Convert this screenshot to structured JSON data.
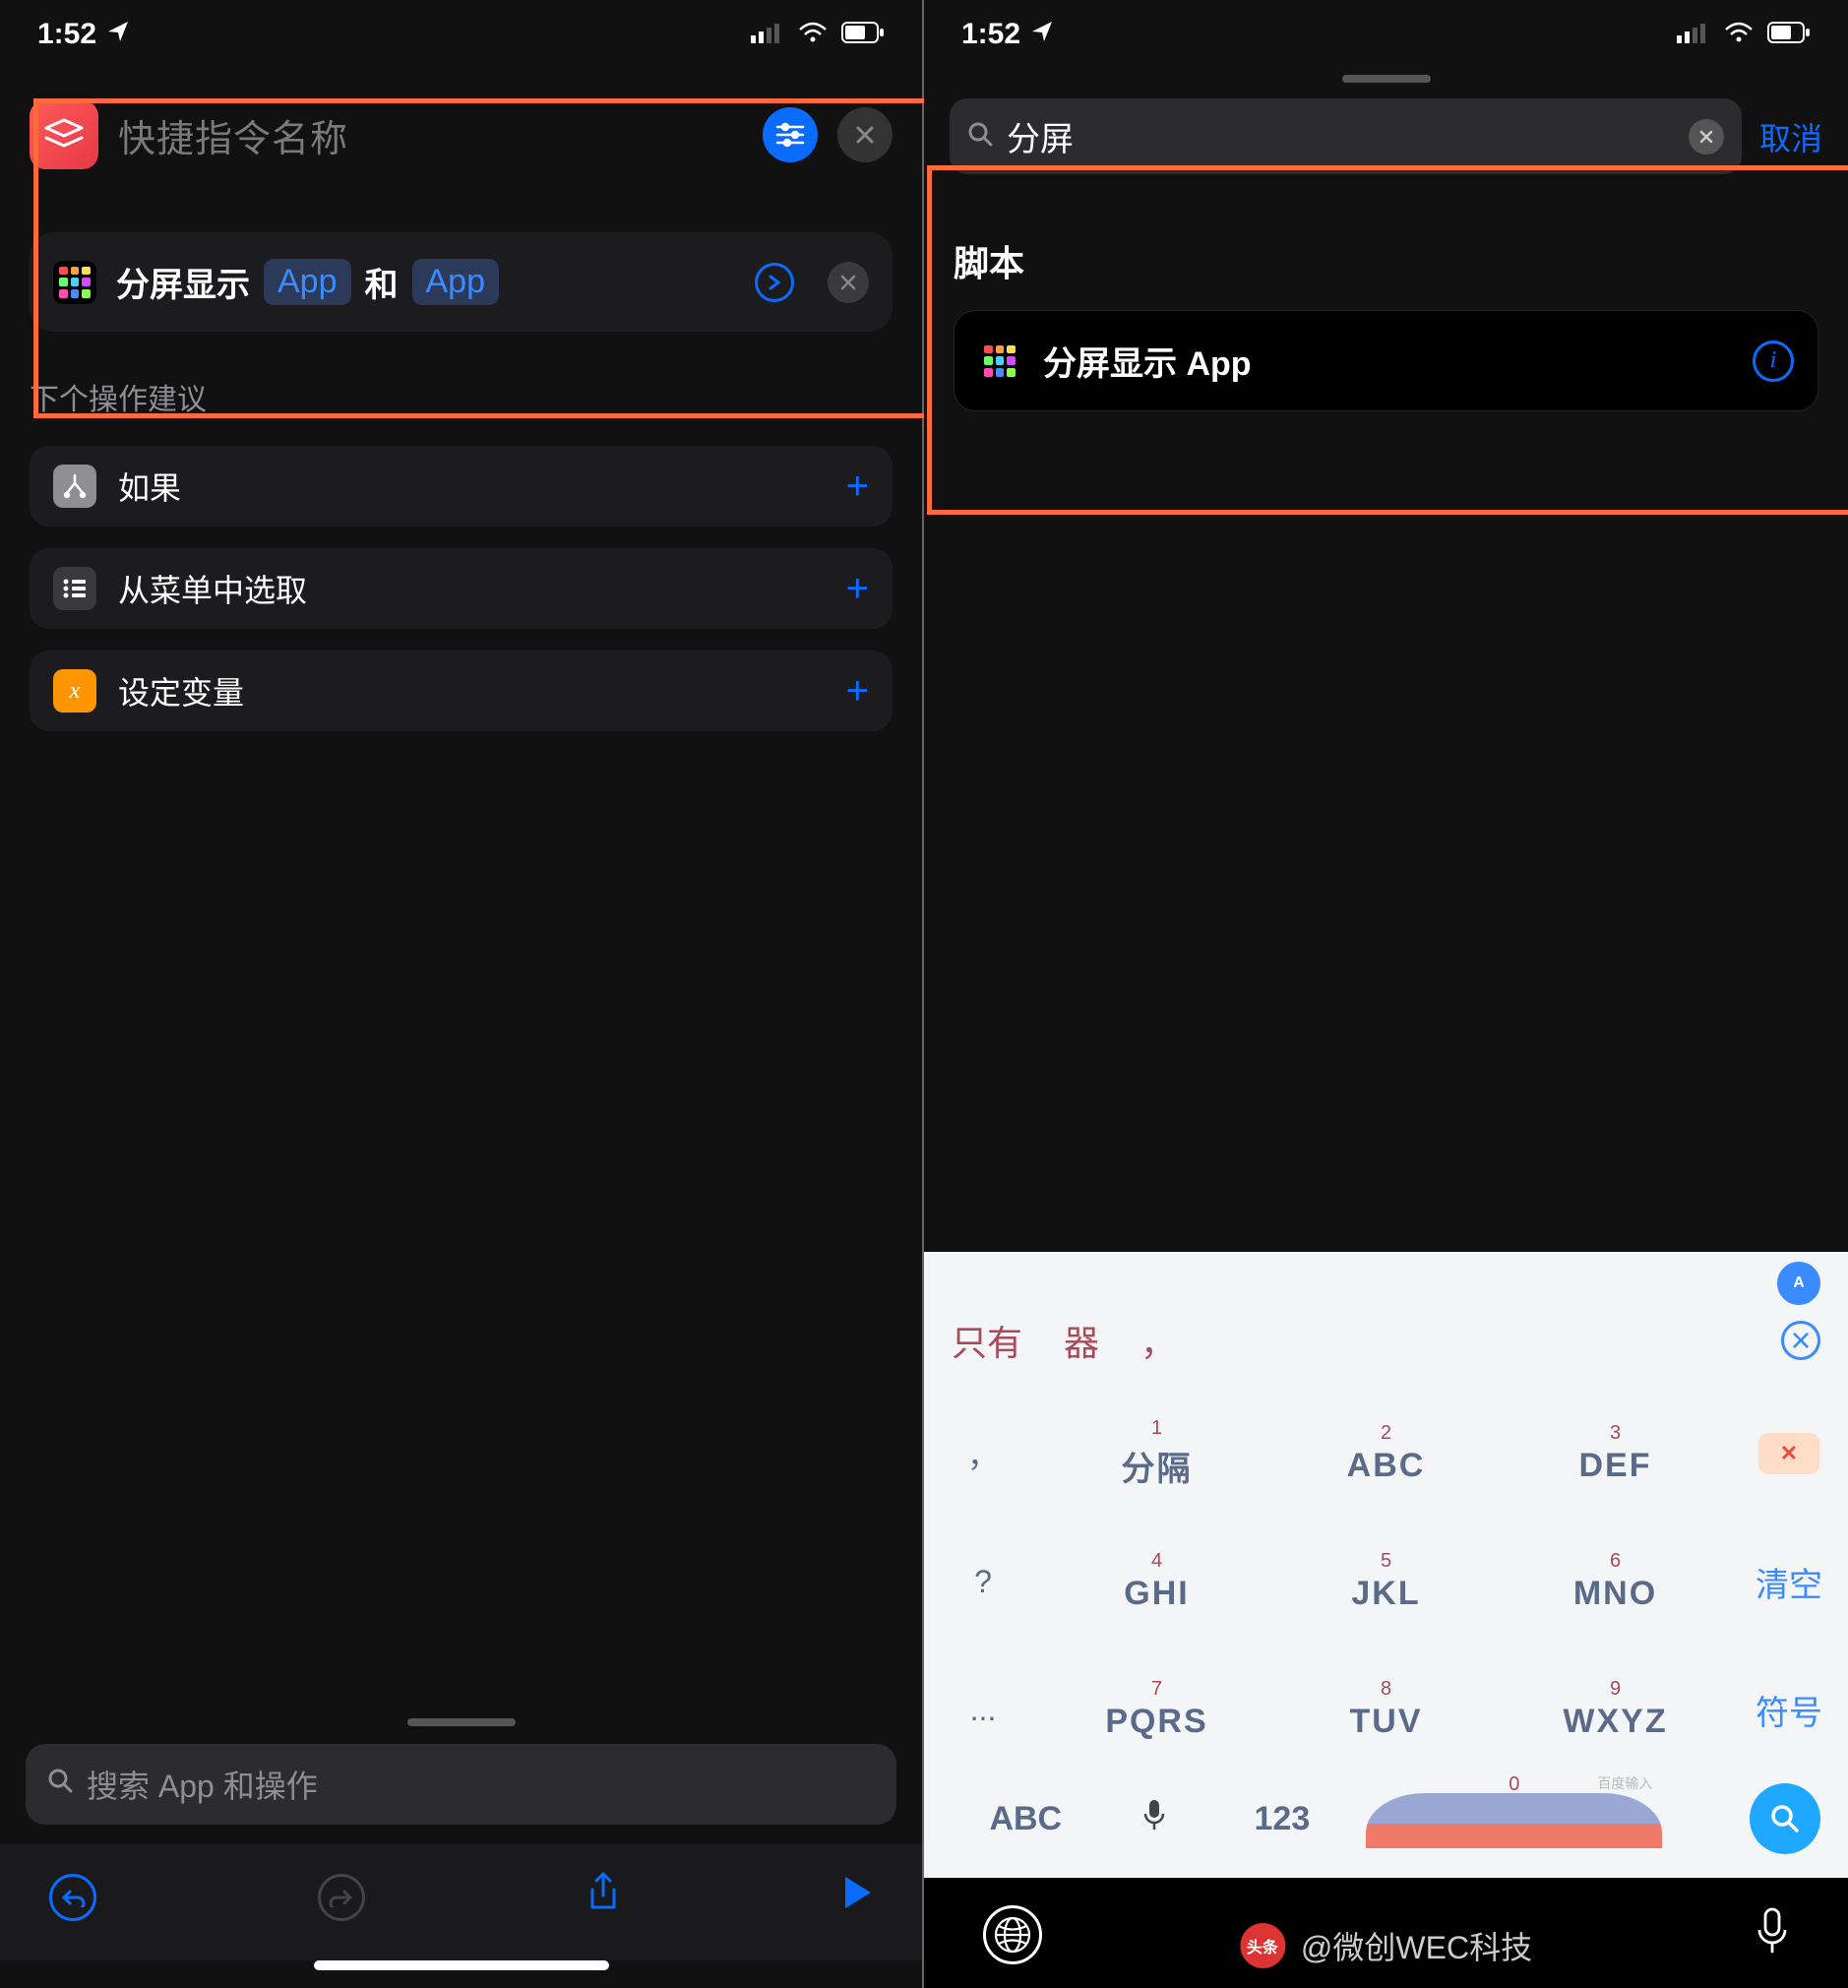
{
  "status": {
    "time": "1:52"
  },
  "left": {
    "title_placeholder": "快捷指令名称",
    "action": {
      "label": "分屏显示",
      "param1": "App",
      "connector": "和",
      "param2": "App"
    },
    "suggestions_header": "下个操作建议",
    "suggestions": [
      {
        "icon": "Y",
        "label": "如果"
      },
      {
        "icon": "≣",
        "label": "从菜单中选取"
      },
      {
        "icon": "x",
        "label": "设定变量"
      }
    ],
    "search_placeholder": "搜索 App 和操作"
  },
  "right": {
    "search_value": "分屏",
    "cancel": "取消",
    "section": "脚本",
    "result_label": "分屏显示 App",
    "candidates": [
      "只有",
      "器",
      "，"
    ],
    "keyboard": {
      "rows": [
        {
          "left": "，",
          "k1": {
            "n": "1",
            "t": "分隔"
          },
          "k2": {
            "n": "2",
            "t": "ABC"
          },
          "k3": {
            "n": "3",
            "t": "DEF"
          },
          "right": "del"
        },
        {
          "left": "?",
          "k1": {
            "n": "4",
            "t": "GHI"
          },
          "k2": {
            "n": "5",
            "t": "JKL"
          },
          "k3": {
            "n": "6",
            "t": "MNO"
          },
          "right": "清空"
        },
        {
          "left": "...",
          "k1": {
            "n": "7",
            "t": "PQRS"
          },
          "k2": {
            "n": "8",
            "t": "TUV"
          },
          "k3": {
            "n": "9",
            "t": "WXYZ"
          },
          "right": "符号"
        }
      ],
      "abc": "ABC",
      "num": "123",
      "space_zero": "0",
      "space_brand": "百度输入"
    }
  },
  "watermark": "@微创WEC科技",
  "watermark_prefix": "头条"
}
